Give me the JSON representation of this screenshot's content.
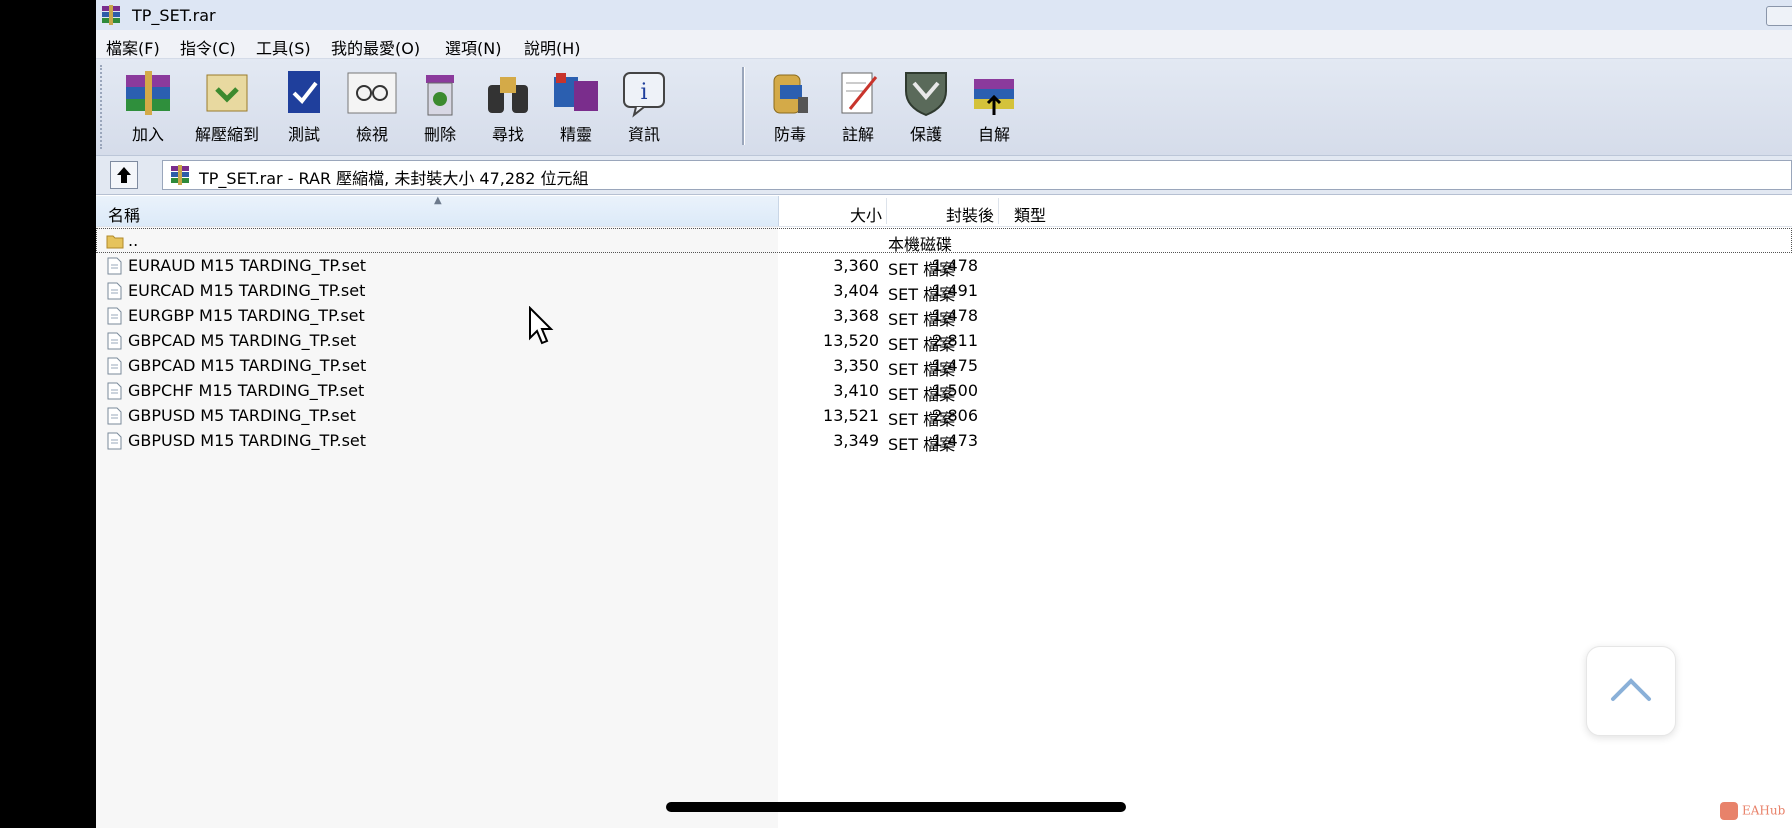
{
  "window": {
    "title": "TP_SET.rar"
  },
  "menu": [
    "檔案(F)",
    "指令(C)",
    "工具(S)",
    "我的最愛(O)",
    "選項(N)",
    "說明(H)"
  ],
  "toolbar": {
    "buttons": [
      "加入",
      "解壓縮到",
      "測試",
      "檢視",
      "刪除",
      "尋找",
      "精靈",
      "資訊",
      "防毒",
      "註解",
      "保護",
      "自解"
    ]
  },
  "address": {
    "text": "TP_SET.rar - RAR 壓縮檔, 未封裝大小 47,282 位元組"
  },
  "columns": {
    "name": "名稱",
    "size": "大小",
    "packed": "封裝後",
    "type": "類型"
  },
  "parent_row": {
    "name": "..",
    "type": "本機磁碟"
  },
  "files": [
    {
      "name": "EURAUD M15 TARDING_TP.set",
      "size": "3,360",
      "packed": "1,478",
      "type": "SET 檔案"
    },
    {
      "name": "EURCAD M15 TARDING_TP.set",
      "size": "3,404",
      "packed": "1,491",
      "type": "SET 檔案"
    },
    {
      "name": "EURGBP M15 TARDING_TP.set",
      "size": "3,368",
      "packed": "1,478",
      "type": "SET 檔案"
    },
    {
      "name": "GBPCAD M5 TARDING_TP.set",
      "size": "13,520",
      "packed": "2,811",
      "type": "SET 檔案"
    },
    {
      "name": "GBPCAD M15 TARDING_TP.set",
      "size": "3,350",
      "packed": "1,475",
      "type": "SET 檔案"
    },
    {
      "name": "GBPCHF M15 TARDING_TP.set",
      "size": "3,410",
      "packed": "1,500",
      "type": "SET 檔案"
    },
    {
      "name": "GBPUSD M5 TARDING_TP.set",
      "size": "13,521",
      "packed": "2,806",
      "type": "SET 檔案"
    },
    {
      "name": "GBPUSD M15 TARDING_TP.set",
      "size": "3,349",
      "packed": "1,473",
      "type": "SET 檔案"
    }
  ],
  "watermark": "EAHub",
  "icons": {
    "app": "winrar-icon",
    "up": "up-folder-icon",
    "folder": "folder-icon",
    "file": "file-icon",
    "scroll_top": "chevron-up-icon",
    "cursor": "mouse-cursor-icon"
  },
  "colors": {
    "titlebar": "#dde6f4",
    "toolbar": "#d5dcea",
    "header_highlight": "#dceaf8"
  }
}
